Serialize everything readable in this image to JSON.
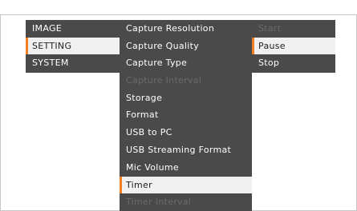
{
  "menu": {
    "accent_color": "#f07f22",
    "panel_color": "#4a4a4a",
    "level1": [
      {
        "label": "IMAGE",
        "state": "normal"
      },
      {
        "label": "SETTING",
        "state": "selected"
      },
      {
        "label": "SYSTEM",
        "state": "normal"
      }
    ],
    "level2": [
      {
        "label": "Capture Resolution",
        "state": "normal"
      },
      {
        "label": "Capture Quality",
        "state": "normal"
      },
      {
        "label": "Capture Type",
        "state": "normal"
      },
      {
        "label": "Capture Interval",
        "state": "disabled"
      },
      {
        "label": "Storage",
        "state": "normal"
      },
      {
        "label": "Format",
        "state": "normal"
      },
      {
        "label": "USB to PC",
        "state": "normal"
      },
      {
        "label": "USB Streaming Format",
        "state": "normal"
      },
      {
        "label": "Mic Volume",
        "state": "normal"
      },
      {
        "label": "Timer",
        "state": "selected"
      },
      {
        "label": "Timer Interval",
        "state": "disabled"
      }
    ],
    "level3": [
      {
        "label": "Start",
        "state": "disabled"
      },
      {
        "label": "Pause",
        "state": "selected"
      },
      {
        "label": "Stop",
        "state": "normal"
      }
    ]
  }
}
